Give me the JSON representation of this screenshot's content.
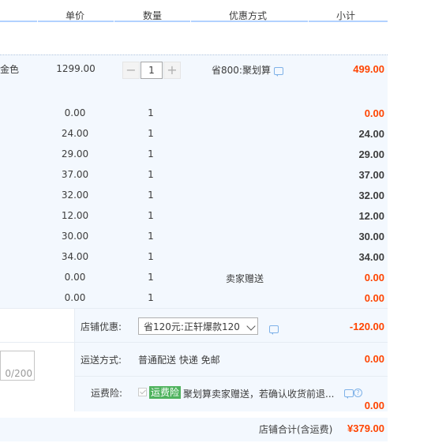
{
  "header": {
    "col_price": "单价",
    "col_qty": "数量",
    "col_promo": "优惠方式",
    "col_subtotal": "小计"
  },
  "main_item": {
    "variant": "金色",
    "price": "1299.00",
    "qty": "1",
    "promo": "省800:聚划算",
    "subtotal": "499.00",
    "minus": "−",
    "plus": "+"
  },
  "rows": [
    {
      "price": "0.00",
      "qty": "1",
      "subtotal": "0.00",
      "red": true,
      "note": ""
    },
    {
      "price": "24.00",
      "qty": "1",
      "subtotal": "24.00",
      "red": false,
      "note": ""
    },
    {
      "price": "29.00",
      "qty": "1",
      "subtotal": "29.00",
      "red": false,
      "note": ""
    },
    {
      "price": "37.00",
      "qty": "1",
      "subtotal": "37.00",
      "red": false,
      "note": ""
    },
    {
      "price": "32.00",
      "qty": "1",
      "subtotal": "32.00",
      "red": false,
      "note": ""
    },
    {
      "price": "12.00",
      "qty": "1",
      "subtotal": "12.00",
      "red": false,
      "note": ""
    },
    {
      "price": "30.00",
      "qty": "1",
      "subtotal": "30.00",
      "red": false,
      "note": ""
    },
    {
      "price": "34.00",
      "qty": "1",
      "subtotal": "34.00",
      "red": false,
      "note": ""
    },
    {
      "price": "0.00",
      "qty": "1",
      "subtotal": "0.00",
      "red": true,
      "note": "卖家赠送"
    },
    {
      "price": "0.00",
      "qty": "1",
      "subtotal": "0.00",
      "red": true,
      "note": ""
    }
  ],
  "shop_discount": {
    "label": "店铺优惠:",
    "selected": "省120元:正轩爆款120",
    "amount": "-120.00"
  },
  "shipping": {
    "label": "运送方式:",
    "value": "普通配送 快递 免邮",
    "amount": "0.00"
  },
  "message": {
    "counter": "0/200"
  },
  "insurance": {
    "label": "运费险:",
    "tag": "运费险",
    "text": "聚划算卖家赠送，若确认收货前退...",
    "amount": "0.00"
  },
  "total": {
    "label": "店铺合计(含运费)",
    "value": "¥379.00"
  },
  "colors": {
    "red": "#ff4400",
    "accent_blue": "#b2d1ff",
    "panel_bg": "#f3f8fe",
    "tag_green": "#4fb35e"
  }
}
